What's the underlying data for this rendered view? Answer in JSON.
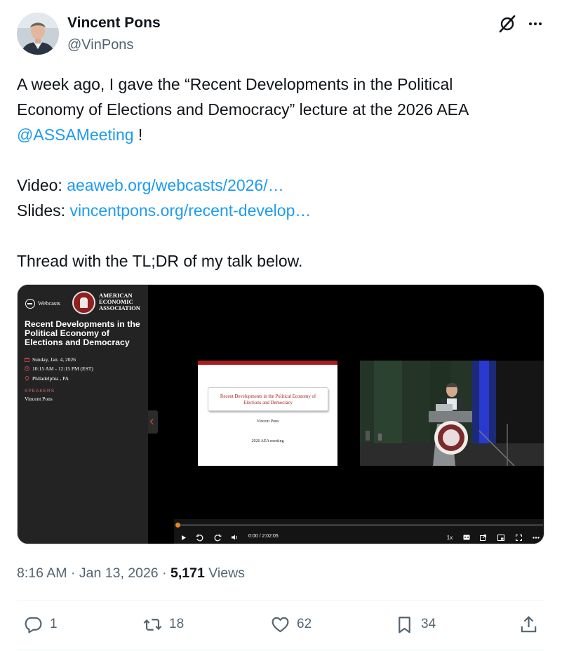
{
  "author": {
    "name": "Vincent Pons",
    "handle": "@VinPons"
  },
  "tweet": {
    "line1": "A week ago, I gave the “Recent Developments in the Political",
    "line2": "Economy of Elections and Democracy” lecture at the 2026 AEA",
    "mention": "@ASSAMeeting",
    "mention_suffix": " !",
    "video_label": "Video: ",
    "video_link": "aeaweb.org/webcasts/2026/…",
    "slides_label": "Slides: ",
    "slides_link": "vincentpons.org/recent-develop…",
    "thread_text": "Thread with the TL;DR of my talk below."
  },
  "media": {
    "webcasts_label": "Webcasts",
    "org_name_lines": [
      "AMERICAN",
      "ECONOMIC",
      "ASSOCIATION"
    ],
    "session_title_lines": [
      "Recent Developments in the",
      "Political Economy of",
      "Elections and Democracy"
    ],
    "date": "Sunday, Jan. 4, 2026",
    "time_range": "10:15 AM - 12:15 PM (EST)",
    "location": "Philadelphia , PA",
    "speakers_heading": "SPEAKERS",
    "speaker": "Vincent Pons",
    "slide_title_lines": [
      "Recent Developments in the Political Economy of",
      "Elections and Democracy"
    ],
    "slide_author": "Vincent Pons",
    "slide_meeting": "2026 AEA meeting",
    "player": {
      "time_display": "0:00 / 2:02:05",
      "speed": "1x",
      "progress": 0
    }
  },
  "meta": {
    "time": "8:16 AM",
    "date": "Jan 13, 2026",
    "views_count": "5,171",
    "views_label": "Views"
  },
  "actions": {
    "replies": "1",
    "reposts": "18",
    "likes": "62",
    "bookmarks": "34"
  },
  "colors": {
    "link": "#1d9bf0",
    "text": "#0f1419",
    "muted": "#536471",
    "aea_red": "#a81e1e",
    "progress": "#e5881e"
  }
}
